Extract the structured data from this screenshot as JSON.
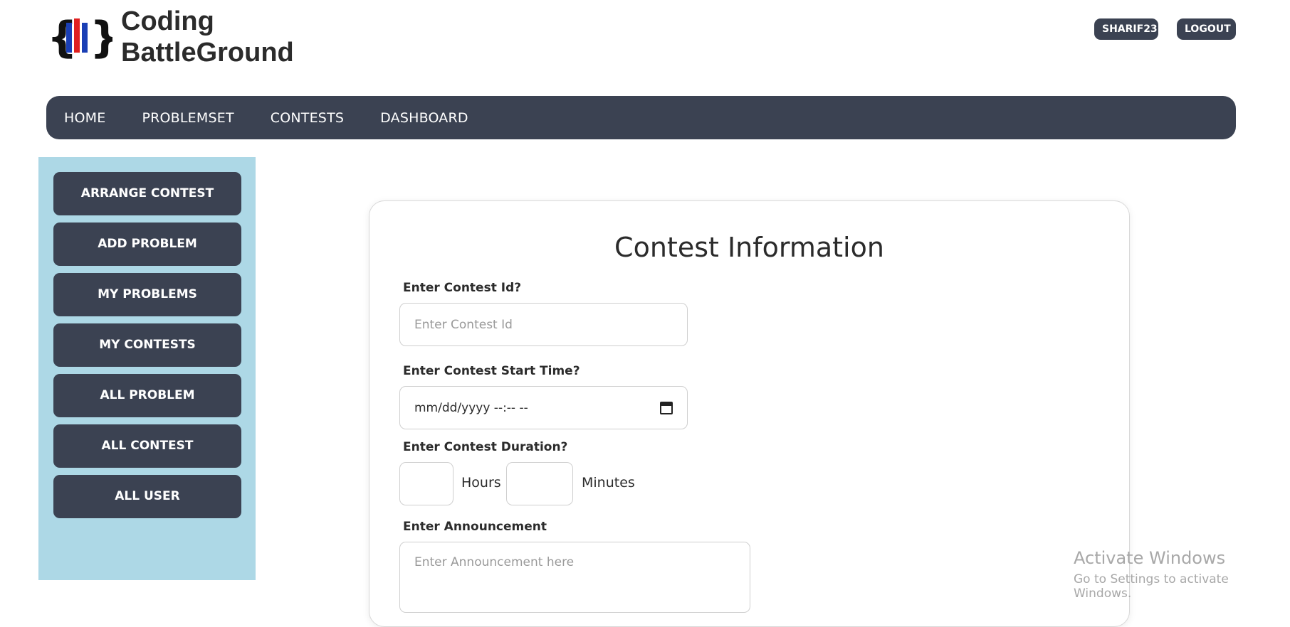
{
  "header": {
    "brand_line1": "Coding",
    "brand_line2": "BattleGround",
    "username": "SHARIF23",
    "logout_label": "LOGOUT"
  },
  "nav": {
    "items": [
      "HOME",
      "PROBLEMSET",
      "CONTESTS",
      "DASHBOARD"
    ]
  },
  "sidebar": {
    "items": [
      "ARRANGE CONTEST",
      "ADD PROBLEM",
      "MY PROBLEMS",
      "MY CONTESTS",
      "ALL PROBLEM",
      "ALL CONTEST",
      "ALL USER"
    ]
  },
  "form": {
    "title": "Contest Information",
    "contest_id_label": "Enter Contest Id?",
    "contest_id_placeholder": "Enter Contest Id",
    "start_time_label": "Enter Contest Start Time?",
    "start_time_placeholder": "mm/dd/yyyy --:-- --",
    "duration_label": "Enter Contest Duration?",
    "hours_label": "Hours",
    "minutes_label": "Minutes",
    "announcement_label": "Enter Announcement",
    "announcement_placeholder": "Enter Announcement here"
  },
  "watermark": {
    "title": "Activate Windows",
    "subtitle": "Go to Settings to activate Windows."
  },
  "colors": {
    "dark": "#3b4252",
    "sidebar_bg": "#add8e6",
    "text": "#2b2b2b"
  },
  "icons": {
    "logo": "code-braces-books-logo",
    "date_picker": "calendar-icon"
  }
}
